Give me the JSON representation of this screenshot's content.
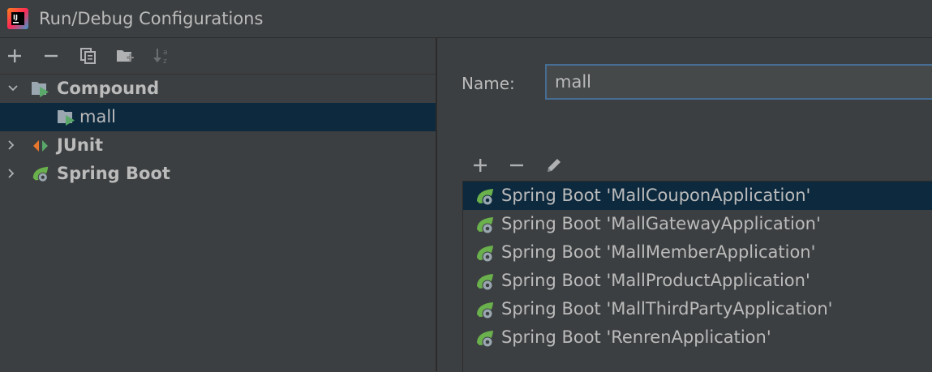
{
  "window": {
    "title": "Run/Debug Configurations"
  },
  "toolbar": {
    "add": "+",
    "remove": "−"
  },
  "tree": {
    "items": [
      {
        "label": "Compound",
        "bold": true
      },
      {
        "label": "mall",
        "bold": false
      },
      {
        "label": "JUnit",
        "bold": true
      },
      {
        "label": "Spring Boot",
        "bold": true
      }
    ]
  },
  "form": {
    "name_label": "Name:",
    "name_value": "mall"
  },
  "list_toolbar": {
    "add": "+",
    "remove": "−"
  },
  "configs": [
    "Spring Boot 'MallCouponApplication'",
    "Spring Boot 'MallGatewayApplication'",
    "Spring Boot 'MallMemberApplication'",
    "Spring Boot 'MallProductApplication'",
    "Spring Boot 'MallThirdPartyApplication'",
    "Spring Boot 'RenrenApplication'"
  ],
  "colors": {
    "background": "#3c3f41",
    "selection": "#0d293e",
    "input_border": "#466d94",
    "text": "#bbbbbb",
    "spring_green": "#6ab04c",
    "run_green": "#59a869"
  }
}
